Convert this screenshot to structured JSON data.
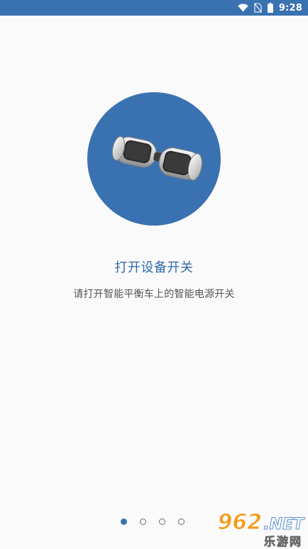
{
  "status_bar": {
    "time": "9:28",
    "icons": [
      "wifi-icon",
      "no-sim-icon",
      "battery-icon"
    ],
    "background": "#3a72b1"
  },
  "hero": {
    "illustration": "hoverboard-icon",
    "circle_color": "#3a72b1"
  },
  "title": "打开设备开关",
  "subtitle": "请打开智能平衡车上的智能电源开关",
  "pager": {
    "total": 4,
    "active_index": 0,
    "active_color": "#3a72b1"
  },
  "watermark": {
    "digits": "962",
    "suffix": ".NET",
    "site_name": "乐游网"
  }
}
